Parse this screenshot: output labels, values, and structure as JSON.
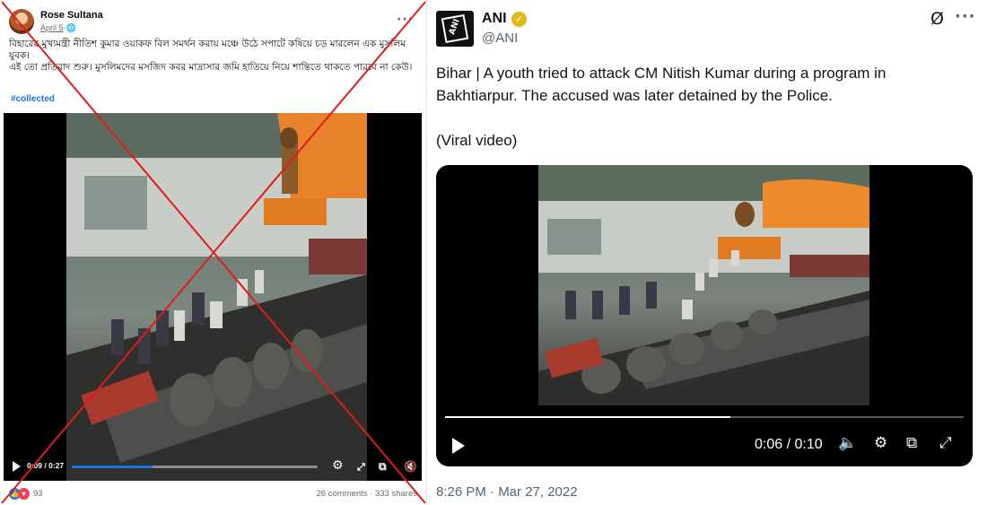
{
  "facebook_post": {
    "author": "Rose Sultana",
    "date": "April 5",
    "privacy_glyph": "·🌐",
    "more_glyph": "···",
    "text_line1": "বিহারের মুখ্যমন্ত্রী নীতিশ কুমার ওয়াকফ বিল সমর্থন করায় মঞ্চে উঠে সপাটে কষিয়ে চড় মারলেন এক মুসলিম যুবক।",
    "text_line2": "এই তো প্রতিবাদ শুরু। মুসলিমদের মসজিদ কবর মাদ্রাসার জমি হাতিয়ে নিয়ে শান্তিতে থাকতে পারবে না কেউ।",
    "hashtag": "#collected",
    "video": {
      "time": "0:09 / 0:27",
      "progress_fraction": 0.33,
      "icons": [
        "settings-icon",
        "fullscreen-icon",
        "pip-icon",
        "mute-icon"
      ]
    },
    "reactions_count": "93",
    "comments": "26 comments",
    "shares": "333 shares",
    "crossed_out_color": "#e01b1b"
  },
  "x_post": {
    "name": "ANI",
    "handle": "@ANI",
    "avatar_text": "ANI",
    "verified_color": "#e2b719",
    "text": "Bihar | A youth tried to attack CM Nitish Kumar during a program in Bakhtiarpur. The accused was later detained by the Police.",
    "text2": "(Viral video)",
    "video": {
      "time": "0:06 / 0:10",
      "progress_fraction": 0.55,
      "icons": [
        "volume-icon",
        "settings-icon",
        "pip-icon",
        "fullscreen-icon"
      ]
    },
    "timestamp": "8:26 PM · Mar 27, 2022",
    "more_glyph": "···",
    "grok_glyph": "Ø"
  }
}
